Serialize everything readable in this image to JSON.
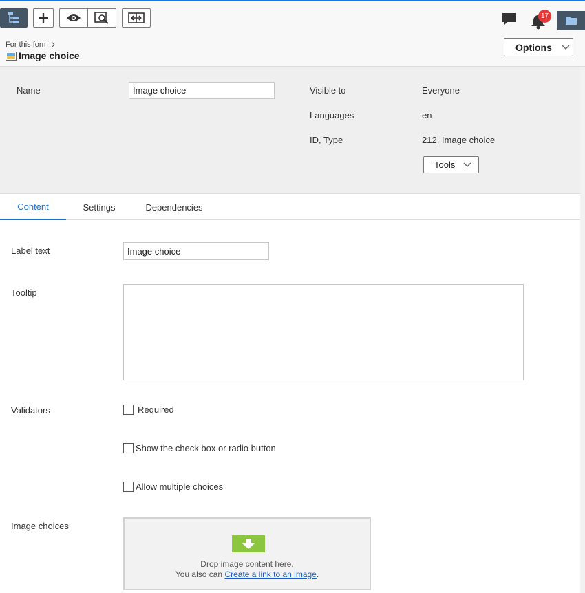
{
  "toolbar": {
    "notifications_count": "17",
    "icons": [
      "page-tree-icon",
      "plus-icon",
      "eye-icon",
      "preview-icon",
      "compare-icon",
      "chat-icon",
      "bell-icon",
      "folder-icon"
    ]
  },
  "header": {
    "breadcrumb": "For this form",
    "title": "Image choice",
    "options_label": "Options"
  },
  "info": {
    "name_label": "Name",
    "name_value": "Image choice",
    "visible_to_label": "Visible to",
    "visible_to_value": "Everyone",
    "languages_label": "Languages",
    "languages_value": "en",
    "id_type_label": "ID, Type",
    "id_type_value": "212, Image choice",
    "tools_label": "Tools"
  },
  "tabs": [
    {
      "label": "Content",
      "active": true
    },
    {
      "label": "Settings",
      "active": false
    },
    {
      "label": "Dependencies",
      "active": false
    }
  ],
  "form": {
    "label_text_label": "Label text",
    "label_text_value": "Image choice",
    "tooltip_label": "Tooltip",
    "tooltip_value": "",
    "validators_label": "Validators",
    "required_label": "Required",
    "show_checkbox_label": "Show the check box or radio button",
    "allow_multiple_label": "Allow multiple choices",
    "image_choices_label": "Image choices",
    "drop_text": "Drop image content here.",
    "drop_also_prefix": "You also can",
    "drop_link": "Create a link to an image",
    "drop_suffix": "."
  },
  "colors": {
    "accent": "#1f6fd1",
    "toolbar_dark": "#445566",
    "badge": "#e5383b",
    "drop_green": "#8cc63f"
  }
}
